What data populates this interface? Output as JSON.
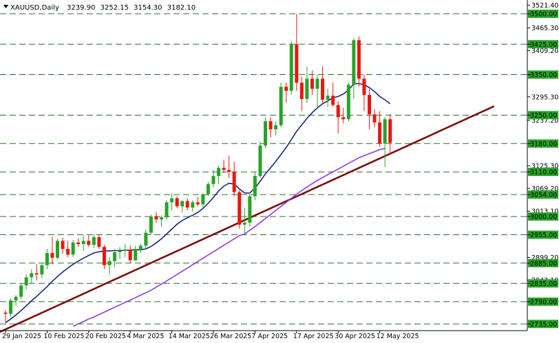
{
  "chart_data": {
    "type": "candlestick",
    "symbol": "XAUUSD",
    "timeframe": "Daily",
    "ohlc_header": {
      "open": "3239.90",
      "high": "3252.15",
      "low": "3154.30",
      "close": "3182.10"
    },
    "ylim": [
      2718.5,
      3534
    ],
    "y_ticks": [
      "3521.40",
      "3465.30",
      "3409.20",
      "3295.30",
      "3237.20",
      "3125.30",
      "3069.20",
      "3013.10",
      "2899.20",
      "2843.10"
    ],
    "x_labels": [
      {
        "index": 0,
        "label": "29 Jan 2025"
      },
      {
        "index": 8,
        "label": "10 Feb 2025"
      },
      {
        "index": 16,
        "label": "20 Feb 2025"
      },
      {
        "index": 24,
        "label": "4 Mar 2025"
      },
      {
        "index": 32,
        "label": "14 Mar 2025"
      },
      {
        "index": 40,
        "label": "26 Mar 2025"
      },
      {
        "index": 48,
        "label": "7 Apr 2025"
      },
      {
        "index": 56,
        "label": "17 Apr 2025"
      },
      {
        "index": 64,
        "label": "30 Apr 2025"
      },
      {
        "index": 72,
        "label": "12 May 2025"
      }
    ],
    "levels": [
      "3500.00",
      "3425.00",
      "3350.00",
      "3250.00",
      "3180.00",
      "3110.00",
      "3054.00",
      "3000.00",
      "2955.00",
      "2885.00",
      "2835.00",
      "2790.00",
      "2735.00"
    ],
    "candles": [
      {
        "o": 2763,
        "h": 2770,
        "l": 2740,
        "c": 2760
      },
      {
        "o": 2760,
        "h": 2798,
        "l": 2753,
        "c": 2793
      },
      {
        "o": 2793,
        "h": 2806,
        "l": 2780,
        "c": 2802
      },
      {
        "o": 2802,
        "h": 2835,
        "l": 2796,
        "c": 2830
      },
      {
        "o": 2830,
        "h": 2858,
        "l": 2820,
        "c": 2850
      },
      {
        "o": 2850,
        "h": 2870,
        "l": 2835,
        "c": 2860
      },
      {
        "o": 2860,
        "h": 2882,
        "l": 2842,
        "c": 2857
      },
      {
        "o": 2857,
        "h": 2885,
        "l": 2848,
        "c": 2880
      },
      {
        "o": 2880,
        "h": 2920,
        "l": 2870,
        "c": 2910
      },
      {
        "o": 2910,
        "h": 2950,
        "l": 2882,
        "c": 2898
      },
      {
        "o": 2898,
        "h": 2945,
        "l": 2895,
        "c": 2940
      },
      {
        "o": 2940,
        "h": 2948,
        "l": 2908,
        "c": 2920
      },
      {
        "o": 2920,
        "h": 2940,
        "l": 2900,
        "c": 2906
      },
      {
        "o": 2906,
        "h": 2942,
        "l": 2900,
        "c": 2936
      },
      {
        "o": 2936,
        "h": 2946,
        "l": 2925,
        "c": 2932
      },
      {
        "o": 2932,
        "h": 2953,
        "l": 2915,
        "c": 2940
      },
      {
        "o": 2940,
        "h": 2955,
        "l": 2925,
        "c": 2930
      },
      {
        "o": 2930,
        "h": 2956,
        "l": 2922,
        "c": 2949
      },
      {
        "o": 2949,
        "h": 2955,
        "l": 2920,
        "c": 2925
      },
      {
        "o": 2925,
        "h": 2930,
        "l": 2870,
        "c": 2880
      },
      {
        "o": 2880,
        "h": 2900,
        "l": 2858,
        "c": 2890
      },
      {
        "o": 2890,
        "h": 2920,
        "l": 2875,
        "c": 2912
      },
      {
        "o": 2912,
        "h": 2925,
        "l": 2895,
        "c": 2915
      },
      {
        "o": 2915,
        "h": 2932,
        "l": 2900,
        "c": 2918
      },
      {
        "o": 2918,
        "h": 2928,
        "l": 2885,
        "c": 2892
      },
      {
        "o": 2892,
        "h": 2928,
        "l": 2890,
        "c": 2920
      },
      {
        "o": 2920,
        "h": 2933,
        "l": 2910,
        "c": 2928
      },
      {
        "o": 2928,
        "h": 2968,
        "l": 2922,
        "c": 2960
      },
      {
        "o": 2960,
        "h": 3005,
        "l": 2955,
        "c": 3000
      },
      {
        "o": 3000,
        "h": 3012,
        "l": 2985,
        "c": 2993
      },
      {
        "o": 2993,
        "h": 3003,
        "l": 2975,
        "c": 2998
      },
      {
        "o": 2998,
        "h": 3040,
        "l": 2992,
        "c": 3035
      },
      {
        "o": 3035,
        "h": 3057,
        "l": 3015,
        "c": 3045
      },
      {
        "o": 3045,
        "h": 3050,
        "l": 3020,
        "c": 3025
      },
      {
        "o": 3025,
        "h": 3040,
        "l": 3010,
        "c": 3038
      },
      {
        "o": 3038,
        "h": 3045,
        "l": 3015,
        "c": 3022
      },
      {
        "o": 3022,
        "h": 3040,
        "l": 3012,
        "c": 3035
      },
      {
        "o": 3035,
        "h": 3048,
        "l": 3025,
        "c": 3030
      },
      {
        "o": 3030,
        "h": 3058,
        "l": 3020,
        "c": 3055
      },
      {
        "o": 3055,
        "h": 3085,
        "l": 3050,
        "c": 3080
      },
      {
        "o": 3080,
        "h": 3115,
        "l": 3072,
        "c": 3100
      },
      {
        "o": 3100,
        "h": 3125,
        "l": 3080,
        "c": 3120
      },
      {
        "o": 3120,
        "h": 3140,
        "l": 3108,
        "c": 3115
      },
      {
        "o": 3115,
        "h": 3150,
        "l": 3095,
        "c": 3110
      },
      {
        "o": 3110,
        "h": 3135,
        "l": 3050,
        "c": 3060
      },
      {
        "o": 3060,
        "h": 3065,
        "l": 2970,
        "c": 2980
      },
      {
        "o": 2980,
        "h": 3022,
        "l": 2958,
        "c": 2985
      },
      {
        "o": 2985,
        "h": 3060,
        "l": 2975,
        "c": 3050
      },
      {
        "o": 3050,
        "h": 3110,
        "l": 3040,
        "c": 3100
      },
      {
        "o": 3100,
        "h": 3185,
        "l": 3095,
        "c": 3175
      },
      {
        "o": 3175,
        "h": 3245,
        "l": 3170,
        "c": 3235
      },
      {
        "o": 3235,
        "h": 3245,
        "l": 3195,
        "c": 3215
      },
      {
        "o": 3215,
        "h": 3235,
        "l": 3200,
        "c": 3225
      },
      {
        "o": 3225,
        "h": 3330,
        "l": 3220,
        "c": 3320
      },
      {
        "o": 3320,
        "h": 3330,
        "l": 3280,
        "c": 3310
      },
      {
        "o": 3310,
        "h": 3432,
        "l": 3300,
        "c": 3425
      },
      {
        "o": 3425,
        "h": 3500,
        "l": 3310,
        "c": 3330
      },
      {
        "o": 3330,
        "h": 3345,
        "l": 3260,
        "c": 3290
      },
      {
        "o": 3290,
        "h": 3370,
        "l": 3280,
        "c": 3340
      },
      {
        "o": 3340,
        "h": 3360,
        "l": 3300,
        "c": 3315
      },
      {
        "o": 3315,
        "h": 3350,
        "l": 3265,
        "c": 3340
      },
      {
        "o": 3340,
        "h": 3370,
        "l": 3280,
        "c": 3288
      },
      {
        "o": 3288,
        "h": 3315,
        "l": 3270,
        "c": 3298
      },
      {
        "o": 3298,
        "h": 3330,
        "l": 3270,
        "c": 3275
      },
      {
        "o": 3275,
        "h": 3285,
        "l": 3205,
        "c": 3245
      },
      {
        "o": 3245,
        "h": 3268,
        "l": 3230,
        "c": 3240
      },
      {
        "o": 3240,
        "h": 3330,
        "l": 3235,
        "c": 3325
      },
      {
        "o": 3325,
        "h": 3440,
        "l": 3290,
        "c": 3435
      },
      {
        "o": 3435,
        "h": 3444,
        "l": 3320,
        "c": 3340
      },
      {
        "o": 3340,
        "h": 3350,
        "l": 3260,
        "c": 3300
      },
      {
        "o": 3300,
        "h": 3315,
        "l": 3215,
        "c": 3252
      },
      {
        "o": 3252,
        "h": 3265,
        "l": 3220,
        "c": 3232
      },
      {
        "o": 3232,
        "h": 3260,
        "l": 3172,
        "c": 3180
      },
      {
        "o": 3180,
        "h": 3245,
        "l": 3122,
        "c": 3240
      },
      {
        "o": 3240,
        "h": 3252,
        "l": 3154,
        "c": 3182
      }
    ],
    "ma_fast": [
      2738,
      2747,
      2757,
      2768,
      2780,
      2792,
      2803,
      2815,
      2827,
      2840,
      2852,
      2863,
      2873,
      2882,
      2890,
      2897,
      2904,
      2910,
      2913,
      2915,
      2915,
      2916,
      2916,
      2917,
      2917,
      2918,
      2918,
      2920,
      2926,
      2935,
      2945,
      2957,
      2969,
      2981,
      2990,
      2997,
      3003,
      3010,
      3020,
      3033,
      3047,
      3063,
      3075,
      3082,
      3080,
      3068,
      3058,
      3058,
      3070,
      3087,
      3105,
      3120,
      3136,
      3153,
      3170,
      3190,
      3210,
      3226,
      3242,
      3256,
      3268,
      3278,
      3285,
      3293,
      3296,
      3302,
      3312,
      3327,
      3328,
      3325,
      3318,
      3308,
      3296,
      3288,
      3278
    ],
    "ma_slow": [
      null,
      null,
      null,
      null,
      null,
      null,
      null,
      null,
      null,
      null,
      null,
      null,
      null,
      2729,
      2735,
      2741,
      2747,
      2752,
      2758,
      2764,
      2770,
      2776,
      2782,
      2788,
      2794,
      2800,
      2806,
      2812,
      2818,
      2826,
      2833,
      2841,
      2849,
      2857,
      2865,
      2873,
      2881,
      2889,
      2897,
      2905,
      2913,
      2921,
      2929,
      2937,
      2945,
      2953,
      2957,
      2966,
      2975,
      2985,
      2995,
      3005,
      3015,
      3025,
      3035,
      3045,
      3055,
      3064,
      3073,
      3081,
      3089,
      3096,
      3103,
      3110,
      3117,
      3124,
      3131,
      3138,
      3145,
      3150,
      3155,
      3160,
      3165,
      3168
    ],
    "trendline": {
      "start": {
        "index": -1.3,
        "value": 2714
      },
      "end": {
        "index": 94,
        "value": 3272
      }
    },
    "colors": {
      "bullish": "#27a327",
      "bearish": "#e8170f",
      "ma_fast": "#1a2574",
      "ma_slow": "#8a3be0",
      "trendline": "#7b0e0e",
      "level_line": "#2d6b2d",
      "level_label_bg": "#27a327",
      "grid": "#d8d8d8",
      "axis": "#000000"
    }
  }
}
